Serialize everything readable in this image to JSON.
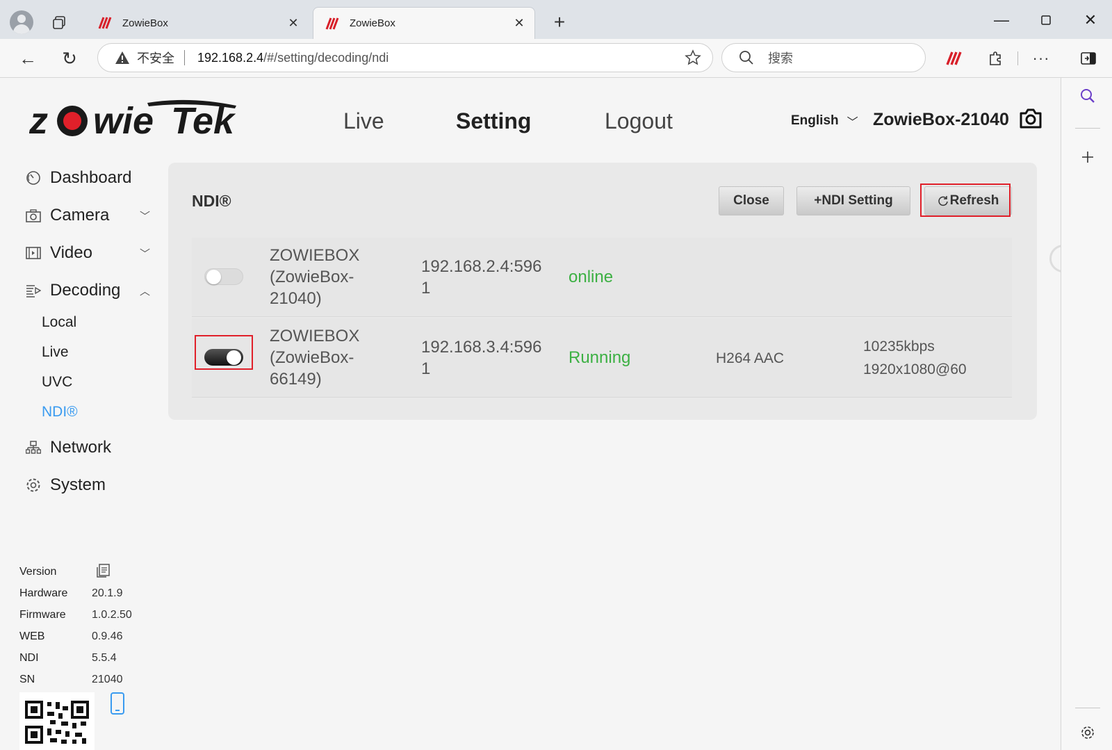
{
  "browser": {
    "tabs": [
      {
        "title": "ZowieBox",
        "active": false
      },
      {
        "title": "ZowieBox",
        "active": true
      }
    ],
    "address": {
      "insecure_label": "不安全",
      "host": "192.168.2.4",
      "path": "/#/setting/decoding/ndi"
    },
    "search_placeholder": "搜索",
    "more_label": "···"
  },
  "header": {
    "nav": {
      "live": "Live",
      "setting": "Setting",
      "logout": "Logout"
    },
    "language": "English",
    "device_name": "ZowieBox-21040"
  },
  "sidebar": {
    "items": [
      {
        "label": "Dashboard"
      },
      {
        "label": "Camera"
      },
      {
        "label": "Video"
      },
      {
        "label": "Decoding"
      },
      {
        "label": "Network"
      },
      {
        "label": "System"
      }
    ],
    "decoding_sub": [
      {
        "label": "Local"
      },
      {
        "label": "Live"
      },
      {
        "label": "UVC"
      },
      {
        "label": "NDI®"
      }
    ]
  },
  "version": {
    "title": "Version",
    "rows": [
      {
        "key": "Hardware",
        "value": "20.1.9"
      },
      {
        "key": "Firmware",
        "value": "1.0.2.50"
      },
      {
        "key": "WEB",
        "value": "0.9.46"
      },
      {
        "key": "NDI",
        "value": "5.5.4"
      },
      {
        "key": "SN",
        "value": "21040"
      }
    ]
  },
  "panel": {
    "title": "NDI®",
    "buttons": {
      "close": "Close",
      "ndi_setting": "+NDI Setting",
      "refresh": "Refresh"
    },
    "rows": [
      {
        "enabled": false,
        "name_l1": "ZOWIEBOX",
        "name_l2": "(ZowieBox-",
        "name_l3": "21040)",
        "ip_l1": "192.168.2.4:596",
        "ip_l2": "1",
        "status": "online",
        "codec": "",
        "bitrate": "",
        "resolution": ""
      },
      {
        "enabled": true,
        "name_l1": "ZOWIEBOX",
        "name_l2": "(ZowieBox-",
        "name_l3": "66149)",
        "ip_l1": "192.168.3.4:596",
        "ip_l2": "1",
        "status": "Running",
        "codec": "H264 AAC",
        "bitrate": "10235kbps",
        "resolution": "1920x1080@60"
      }
    ]
  },
  "colors": {
    "accent": "#3a9bf0",
    "status_green": "#3cb043",
    "highlight_red": "#e0202a",
    "brand_red": "#e0202a"
  }
}
